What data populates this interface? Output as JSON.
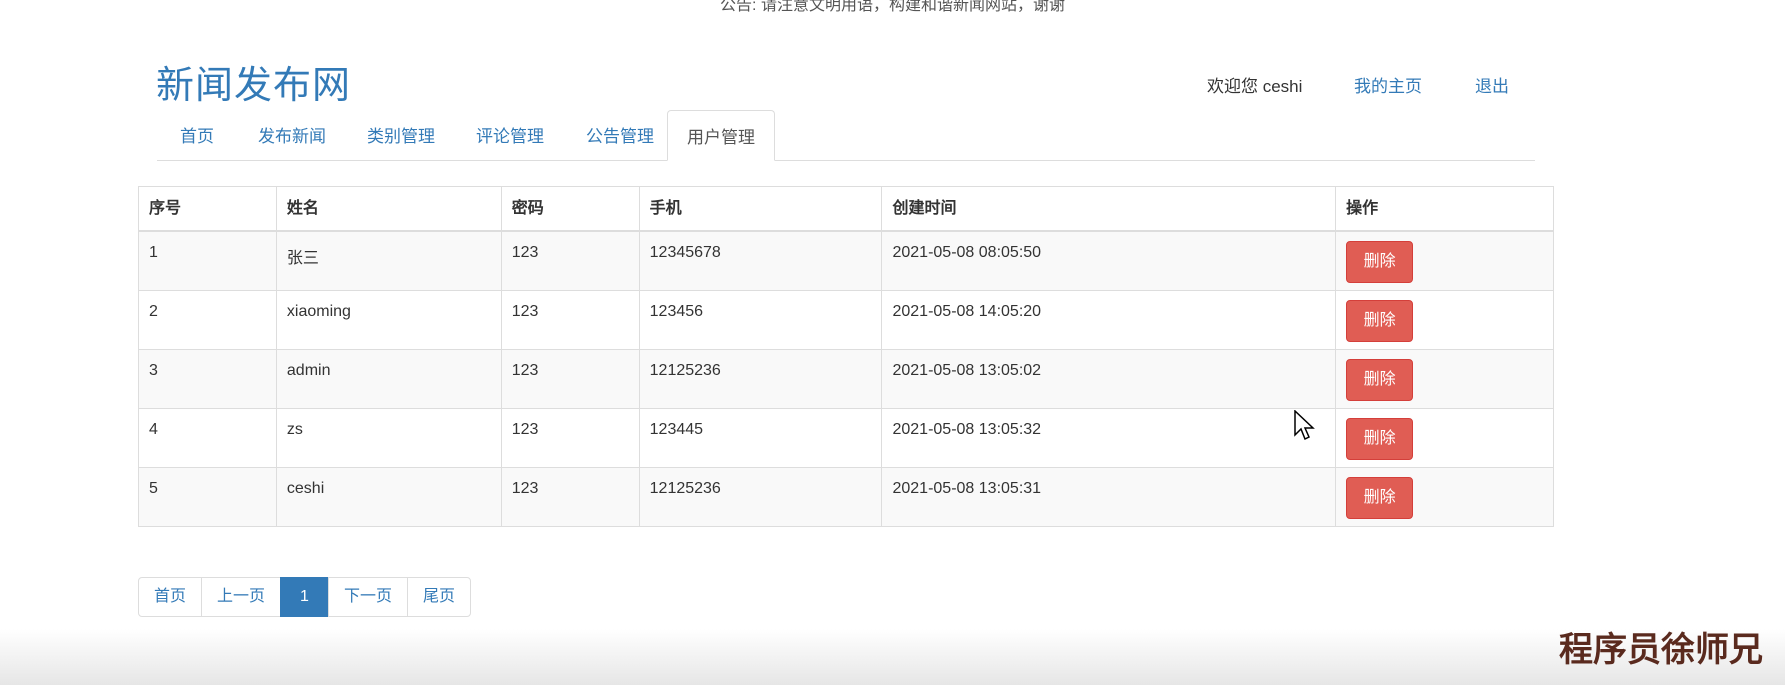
{
  "notice": "公告: 请注意文明用语，构建和谐新闻网站，谢谢",
  "site": {
    "title": "新闻发布网"
  },
  "user_bar": {
    "welcome": "欢迎您 ceshi",
    "home_link": "我的主页",
    "logout_link": "退出"
  },
  "nav": {
    "tabs": [
      {
        "label": "首页"
      },
      {
        "label": "发布新闻"
      },
      {
        "label": "类别管理"
      },
      {
        "label": "评论管理"
      },
      {
        "label": "公告管理"
      },
      {
        "label": "用户管理",
        "active": true
      }
    ]
  },
  "table": {
    "headers": [
      "序号",
      "姓名",
      "密码",
      "手机",
      "创建时间",
      "操作"
    ],
    "rows": [
      {
        "id": "1",
        "name": "张三",
        "password": "123",
        "phone": "12345678",
        "created": "2021-05-08 08:05:50",
        "action": "删除"
      },
      {
        "id": "2",
        "name": "xiaoming",
        "password": "123",
        "phone": "123456",
        "created": "2021-05-08 14:05:20",
        "action": "删除"
      },
      {
        "id": "3",
        "name": "admin",
        "password": "123",
        "phone": "12125236",
        "created": "2021-05-08 13:05:02",
        "action": "删除"
      },
      {
        "id": "4",
        "name": "zs",
        "password": "123",
        "phone": "123445",
        "created": "2021-05-08 13:05:32",
        "action": "删除"
      },
      {
        "id": "5",
        "name": "ceshi",
        "password": "123",
        "phone": "12125236",
        "created": "2021-05-08 13:05:31",
        "action": "删除"
      }
    ]
  },
  "pagination": {
    "first": "首页",
    "prev": "上一页",
    "current": "1",
    "next": "下一页",
    "last": "尾页"
  },
  "watermark": "程序员徐师兄",
  "colors": {
    "primary": "#337ab7",
    "danger": "#d9534f",
    "border": "#dddddd"
  }
}
